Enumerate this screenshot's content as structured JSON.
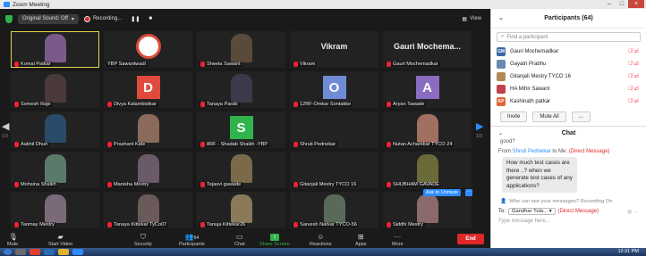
{
  "window": {
    "title": "Zoom Meeting"
  },
  "topbar": {
    "sound": "Original Sound: Off",
    "recording": "Recording...",
    "view": "View"
  },
  "tiles": [
    {
      "name": "Komal Patkar",
      "kind": "photo",
      "color": "#7a5a8a",
      "active": true
    },
    {
      "name": "YBP Sawantwadi",
      "kind": "logo",
      "color": "#c0392b"
    },
    {
      "name": "Sheela Sawant",
      "kind": "photo",
      "color": "#5a4a3a"
    },
    {
      "name": "Vikram",
      "kind": "text",
      "label": "Vikram"
    },
    {
      "name": "Gauri Mochemadkar",
      "kind": "text",
      "label": "Gauri Mochema..."
    },
    {
      "name": "Somesh Raje",
      "kind": "photo",
      "color": "#4a3a3a"
    },
    {
      "name": "Divya Kalambistkar",
      "kind": "letter",
      "letter": "D",
      "color": "#e04a3c"
    },
    {
      "name": "Tanaya Parab",
      "kind": "photo",
      "color": "#3a3a4a"
    },
    {
      "name": "12RF-Omkar Sontakke",
      "kind": "letter",
      "letter": "O",
      "color": "#6f8bd6"
    },
    {
      "name": "Aryan Tawade",
      "kind": "letter",
      "letter": "A",
      "color": "#8a6cc0"
    },
    {
      "name": "Aakhil Dhuri",
      "kind": "photo",
      "color": "#2a4a6a"
    },
    {
      "name": "Prashant Kate",
      "kind": "photo",
      "color": "#8a6a5a"
    },
    {
      "name": "8RF - Shadab Shaikh -YBP",
      "kind": "letter",
      "letter": "S",
      "color": "#2fb34a"
    },
    {
      "name": "Shruti Pednekar",
      "kind": "blank"
    },
    {
      "name": "Nutan Acharekar TYCO 24",
      "kind": "photo",
      "color": "#a07060"
    },
    {
      "name": "Mohsina Shaikh",
      "kind": "photo",
      "color": "#5a7a6a"
    },
    {
      "name": "Manisha Mestry",
      "kind": "photo",
      "color": "#6a5a6a"
    },
    {
      "name": "Tejasvi gawade",
      "kind": "photo",
      "color": "#7a6a4a"
    },
    {
      "name": "Gitanjali Mestry TYCO 16",
      "kind": "blank"
    },
    {
      "name": "SHUBHAM GAVADE",
      "kind": "photo",
      "color": "#6a6a3a"
    },
    {
      "name": "Tanmay Mestry",
      "kind": "photo",
      "color": "#7a6a7a"
    },
    {
      "name": "Tanaya Kittekar TyCo07",
      "kind": "photo",
      "color": "#6a5a5a"
    },
    {
      "name": "Tanuja Kittekar26",
      "kind": "photo",
      "color": "#8a7a5a"
    },
    {
      "name": "Sarvesh Narkar TYCO-56",
      "kind": "photo",
      "color": "#5a6a5a"
    },
    {
      "name": "Siddhi Mestry",
      "kind": "photo",
      "color": "#8a6a6a"
    }
  ],
  "page": {
    "left": "1/3",
    "right": "1/3"
  },
  "unmute": "Ask to Unmute",
  "toolbar": {
    "mute": "Mute",
    "video": "Start Video",
    "security": "Security",
    "participants": "Participants",
    "participants_count": "64",
    "chat": "Chat",
    "share": "Share Screen",
    "reactions": "Reactions",
    "apps": "Apps",
    "more": "More",
    "end": "End"
  },
  "sidebar": {
    "title": "Participants (64)",
    "search_placeholder": "Find a participant",
    "participants": [
      {
        "name": "Gauri Mochemadkar",
        "initials": "GM",
        "color": "#3a6aa0"
      },
      {
        "name": "Gayatri Prabhu",
        "initials": "",
        "color": "#6a8ab0"
      },
      {
        "name": "Gitanjali Mestry TYCO 16",
        "initials": "",
        "color": "#b08a5a"
      },
      {
        "name": "HA Mihir Sawant",
        "initials": "",
        "color": "#c04050"
      },
      {
        "name": "Kashinath patkar",
        "initials": "KP",
        "color": "#e0663c"
      }
    ],
    "invite": "Invite",
    "mute_all": "Mute All",
    "more": "...",
    "chat_title": "Chat",
    "prev_msg": "good?",
    "from_label": "From",
    "from_name": "Shruti Pednekar",
    "to_me": "to Me:",
    "direct": "(Direct Message)",
    "message": "How much test cases are there ..? when we generate test cases of any applications?",
    "who_see": "Who can see your messages? Recording On",
    "to_label": "To:",
    "to_name": "Gandhar Tula...",
    "to_direct": "(Direct Message)",
    "placeholder": "Type message here..."
  },
  "clock": "12:31 PM"
}
